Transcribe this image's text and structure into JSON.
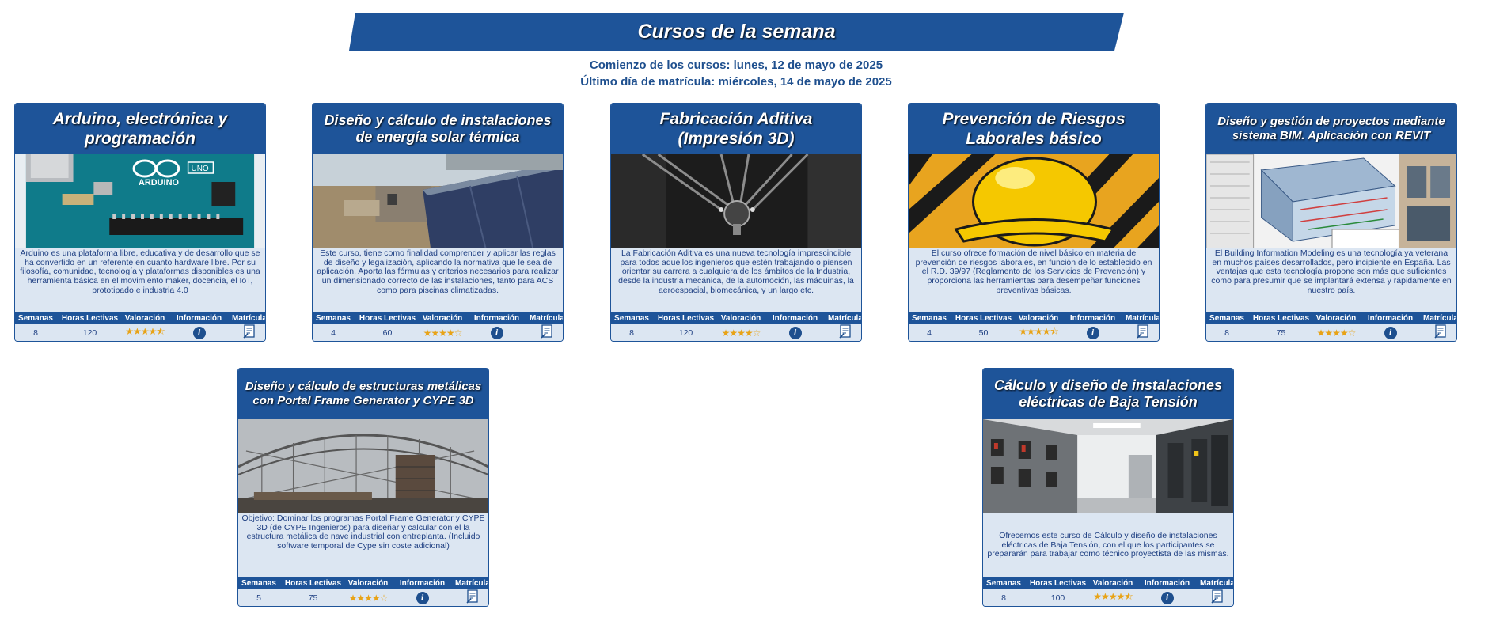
{
  "banner": {
    "title": "Cursos de la semana"
  },
  "dates": {
    "start": "Comienzo de los cursos: lunes, 12 de mayo de 2025",
    "deadline": "Último día de matrícula: miércoles, 14 de mayo de 2025"
  },
  "stat_headers": {
    "weeks": "Semanas",
    "hours": "Horas Lectivas",
    "rating": "Valoración",
    "info": "Información",
    "enroll": "Matrícula"
  },
  "courses": [
    {
      "title": "Arduino, electrónica y programación",
      "image": "arduino-board",
      "description": "Arduino es una plataforma libre, educativa y de desarrollo que se ha convertido en un referente en cuanto hardware libre. Por su filosofía, comunidad, tecnología y plataformas disponibles es una herramienta básica en el movimiento maker, docencia, el IoT, prototipado e industria 4.0",
      "weeks": "8",
      "hours": "120",
      "rating_stars": 4.5,
      "rating_text": "★★★★⯪"
    },
    {
      "title": "Diseño y cálculo de instalaciones de energía solar térmica",
      "image": "solar-panel",
      "description": "Este curso, tiene como finalidad comprender y aplicar las reglas de diseño y legalización, aplicando la normativa que le sea de aplicación. Aporta las fórmulas y criterios necesarios para realizar un dimensionado correcto de las instalaciones, tanto para ACS como para piscinas climatizadas.",
      "weeks": "4",
      "hours": "60",
      "rating_stars": 4,
      "rating_text": "★★★★☆"
    },
    {
      "title": "Fabricación Aditiva (Impresión 3D)",
      "image": "3d-printer",
      "description": "La Fabricación Aditiva es una nueva tecnología imprescindible para todos aquellos ingenieros que estén trabajando o piensen orientar su carrera a cualquiera de los ámbitos de la Industria, desde la industria mecánica, de la automoción, las máquinas, la aeroespacial, biomecánica, y un largo etc.",
      "weeks": "8",
      "hours": "120",
      "rating_stars": 4,
      "rating_text": "★★★★☆"
    },
    {
      "title": "Prevención de Riesgos Laborales básico",
      "image": "safety-helmet",
      "description": "El curso ofrece formación de nivel básico en materia de prevención de riesgos laborales, en función de lo establecido en el R.D. 39/97 (Reglamento de los Servicios de Prevención) y proporciona las herramientas para desempeñar funciones preventivas básicas.",
      "weeks": "4",
      "hours": "50",
      "rating_stars": 4.5,
      "rating_text": "★★★★⯪"
    },
    {
      "title": "Diseño y gestión de proyectos mediante sistema BIM. Aplicación con REVIT",
      "image": "bim-model",
      "description": "El Building Information Modeling es una tecnología ya veterana en muchos países desarrollados, pero incipiente en España. Las ventajas que esta tecnología propone son más que suficientes como para presumir que se implantará extensa y rápidamente en nuestro país.",
      "weeks": "8",
      "hours": "75",
      "rating_stars": 4,
      "rating_text": "★★★★☆"
    },
    {
      "title": "Diseño y cálculo de estructuras metálicas con Portal Frame Generator y CYPE 3D",
      "image": "steel-structure",
      "description": "Objetivo: Dominar los programas Portal Frame Generator y CYPE 3D (de CYPE Ingenieros) para diseñar y calcular con el la estructura metálica de nave industrial con entreplanta. (Incluido software temporal de Cype sin coste adicional)",
      "weeks": "5",
      "hours": "75",
      "rating_stars": 4,
      "rating_text": "★★★★☆"
    },
    {
      "title": "Cálculo y diseño de instalaciones eléctricas de Baja Tensión",
      "image": "electrical-cabinets",
      "description": "Ofrecemos este curso de Cálculo y diseño de instalaciones eléctricas de Baja Tensión, con el que los participantes se prepararán para trabajar como técnico proyectista de las mismas.",
      "weeks": "8",
      "hours": "100",
      "rating_stars": 4.5,
      "rating_text": "★★★★⯪"
    }
  ],
  "colors": {
    "brand_blue": "#1e5499",
    "card_bg": "#dce6f2",
    "text_blue": "#1e3f82",
    "star": "#e8a317"
  }
}
